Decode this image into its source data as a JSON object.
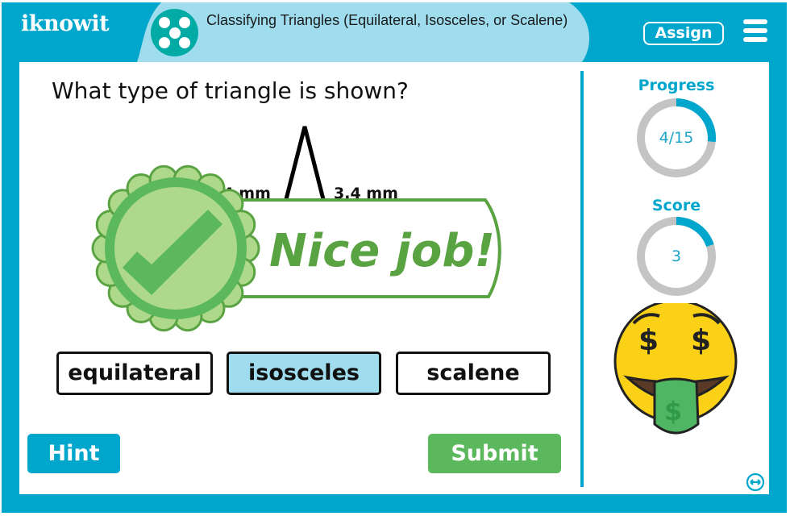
{
  "app": {
    "logo_text": "iknowit",
    "lesson_title": "Classifying Triangles (Equilateral, Isosceles, or Scalene)",
    "assign_label": "Assign",
    "menu_icon": "hamburger-menu-icon",
    "topic_icon": "dots-pattern-icon"
  },
  "question": {
    "prompt": "What type of triangle is shown?",
    "triangle": {
      "left_side_label": "3.4 mm",
      "right_side_label": "3.4 mm"
    }
  },
  "feedback": {
    "message": "Nice job!",
    "icon": "checkmark-badge-icon",
    "colors": {
      "dark": "#5aa343",
      "ring": "#5cb85c",
      "light": "#aed98b"
    }
  },
  "options": [
    {
      "label": "equilateral",
      "selected": false
    },
    {
      "label": "isosceles",
      "selected": true
    },
    {
      "label": "scalene",
      "selected": false
    }
  ],
  "actions": {
    "hint_label": "Hint",
    "submit_label": "Submit"
  },
  "sidebar": {
    "progress": {
      "label": "Progress",
      "text": "4/15",
      "current": 4,
      "total": 15
    },
    "score": {
      "label": "Score",
      "text": "3",
      "fraction": 0.2
    },
    "mascot": "money-face-emoji-icon",
    "expand_icon": "expand-arrows-icon"
  },
  "colors": {
    "brand": "#00a6cc",
    "header_light": "#9edcee",
    "topic_icon": "#00aaa5",
    "ring_track": "#c4c4c4",
    "submit": "#5cb85c",
    "selected_option": "#9edcee"
  }
}
